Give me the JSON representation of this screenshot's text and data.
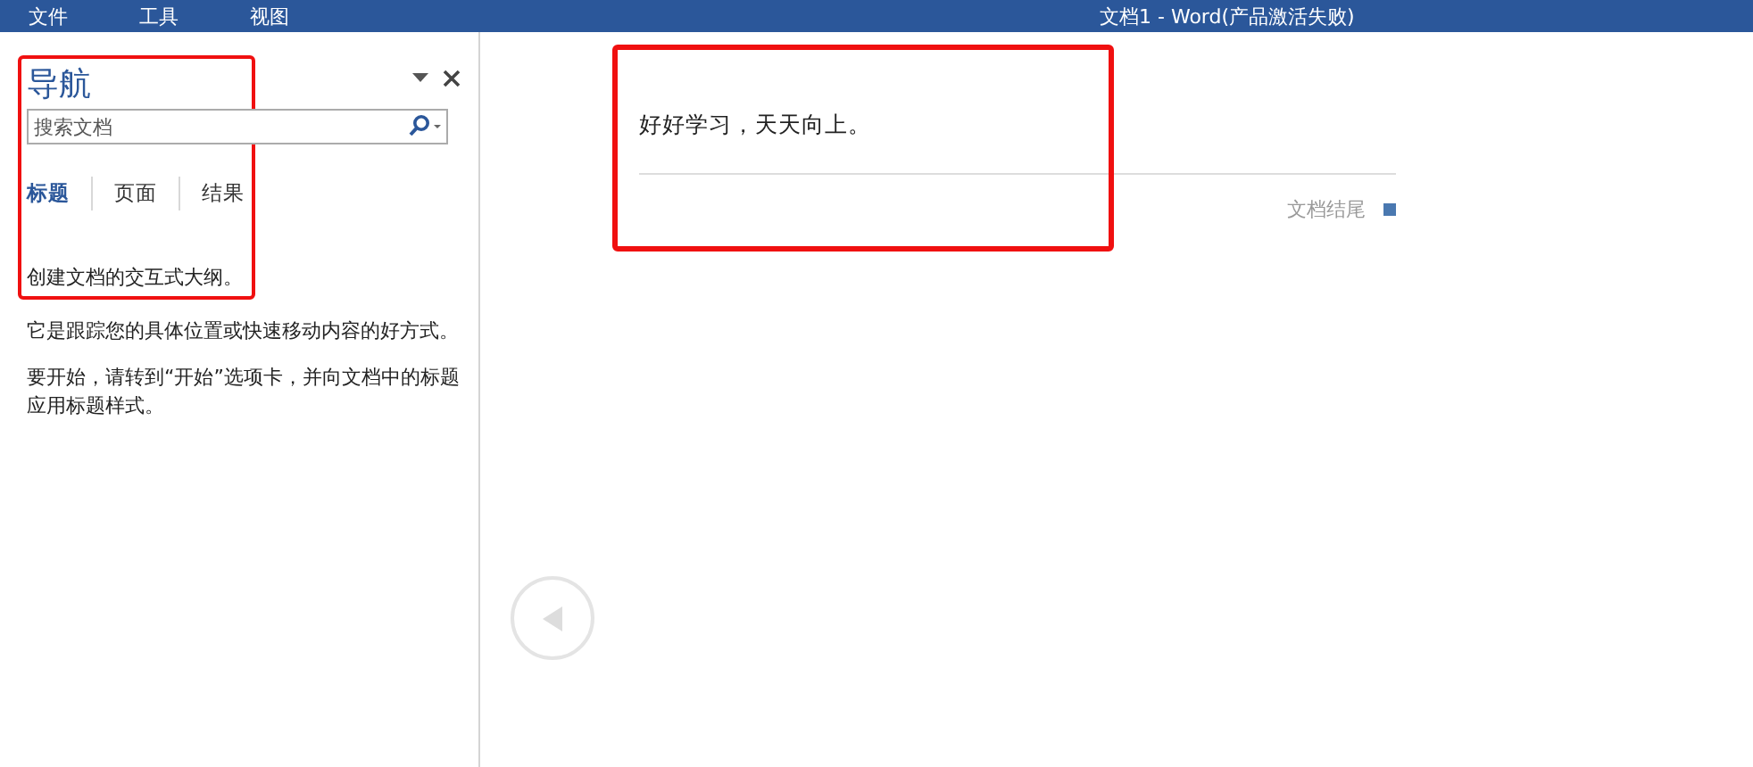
{
  "menu_bar": {
    "items": [
      "文件",
      "工具",
      "视图"
    ],
    "title": "文档1 - Word(产品激活失败)"
  },
  "navigation": {
    "title": "导航",
    "highlighted": true,
    "search": {
      "placeholder": "搜索文档"
    },
    "tabs": [
      {
        "label": "标题",
        "selected": true
      },
      {
        "label": "页面",
        "selected": false
      },
      {
        "label": "结果",
        "selected": false
      }
    ],
    "paragraphs": [
      "创建文档的交互式大纲。",
      "它是跟踪您的具体位置或快速移动内容的好方式。",
      "要开始，请转到“开始”选项卡，并向文档中的标题应用标题样式。"
    ]
  },
  "document": {
    "highlighted": true,
    "text": "好好学习，天天向上。",
    "end_label": "文档结尾"
  }
}
